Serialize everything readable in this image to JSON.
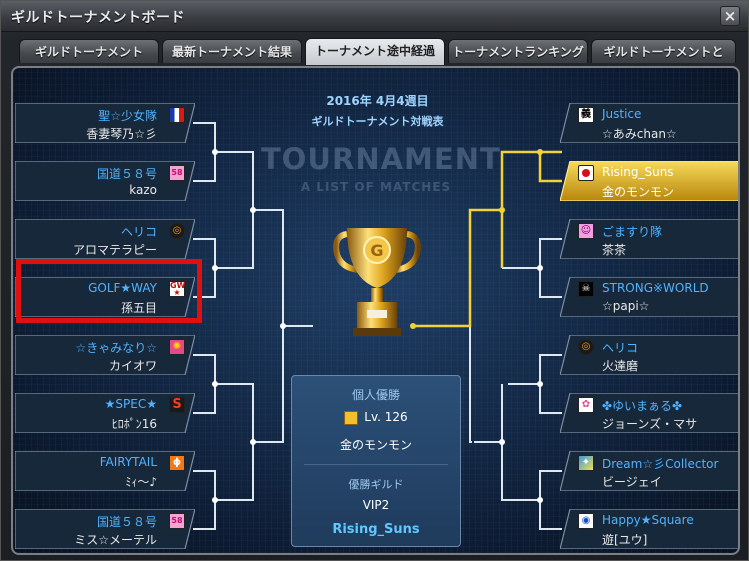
{
  "window": {
    "title": "ギルドトーナメントボード",
    "close_label": "×"
  },
  "tabs": [
    {
      "label": "ギルドトーナメント",
      "active": false
    },
    {
      "label": "最新トーナメント結果",
      "active": false
    },
    {
      "label": "トーナメント途中経過",
      "active": true
    },
    {
      "label": "トーナメントランキング",
      "active": false
    },
    {
      "label": "ギルドトーナメントとは？",
      "active": false
    }
  ],
  "board": {
    "date": "2016年 4月4週目",
    "subtitle": "ギルドトーナメント対戦表",
    "bg_title": "TOURNAMENT",
    "bg_subtitle": "A LIST OF MATCHES"
  },
  "left_teams": [
    {
      "name": "聖☆少女隊",
      "leader": "香妻琴乃☆彡",
      "emblem": "french-flag"
    },
    {
      "name": "国道５８号",
      "leader": "kazo",
      "emblem": "pink-58-badge"
    },
    {
      "name": "ヘリコ",
      "leader": "アロマテラピー",
      "emblem": "orange-spiral"
    },
    {
      "name": "GOLF★WAY",
      "leader": "孫五目",
      "emblem": "gw-star-badge"
    },
    {
      "name": "☆きゃみなり☆",
      "leader": "カイオワ",
      "emblem": "pink-swirl"
    },
    {
      "name": "★SPEC★",
      "leader": "ﾋﾛﾎﾟﾝ16",
      "emblem": "red-s-badge"
    },
    {
      "name": "FAIRYTAIL",
      "leader": "ﾐｨ～♪",
      "emblem": "fairytail-logo"
    },
    {
      "name": "国道５８号",
      "leader": "ミス☆メーテル",
      "emblem": "pink-58-badge"
    }
  ],
  "right_teams": [
    {
      "name": "Justice",
      "leader": "☆あみchan☆",
      "emblem": "kanji-badge"
    },
    {
      "name": "Rising_Suns",
      "leader": "金のモンモン",
      "emblem": "rising-sun",
      "winner": true
    },
    {
      "name": "ごますり隊",
      "leader": "茶茶",
      "emblem": "pink-face"
    },
    {
      "name": "STRONG※WORLD",
      "leader": "☆papi☆",
      "emblem": "skull-badge"
    },
    {
      "name": "ヘリコ",
      "leader": "火達磨",
      "emblem": "orange-spiral"
    },
    {
      "name": "✤ゆいまぁる✤",
      "leader": "ジョーンズ・マサ",
      "emblem": "flower-badge"
    },
    {
      "name": "Dream☆彡Collector",
      "leader": "ビージェイ",
      "emblem": "dream-badge"
    },
    {
      "name": "Happy★Square",
      "leader": "遊[ユウ]",
      "emblem": "eye-badge"
    }
  ],
  "results": {
    "personal_label": "個人優勝",
    "level": "Lv. 126",
    "player": "金のモンモン",
    "guild_label": "優勝ギルド",
    "guild_server": "VIP2",
    "guild_name": "Rising_Suns"
  },
  "colors": {
    "accent_blue": "#4fb3ff",
    "winner_gold": "#f2d23a",
    "line": "#dfe7f0",
    "highlight": "#e01010"
  }
}
